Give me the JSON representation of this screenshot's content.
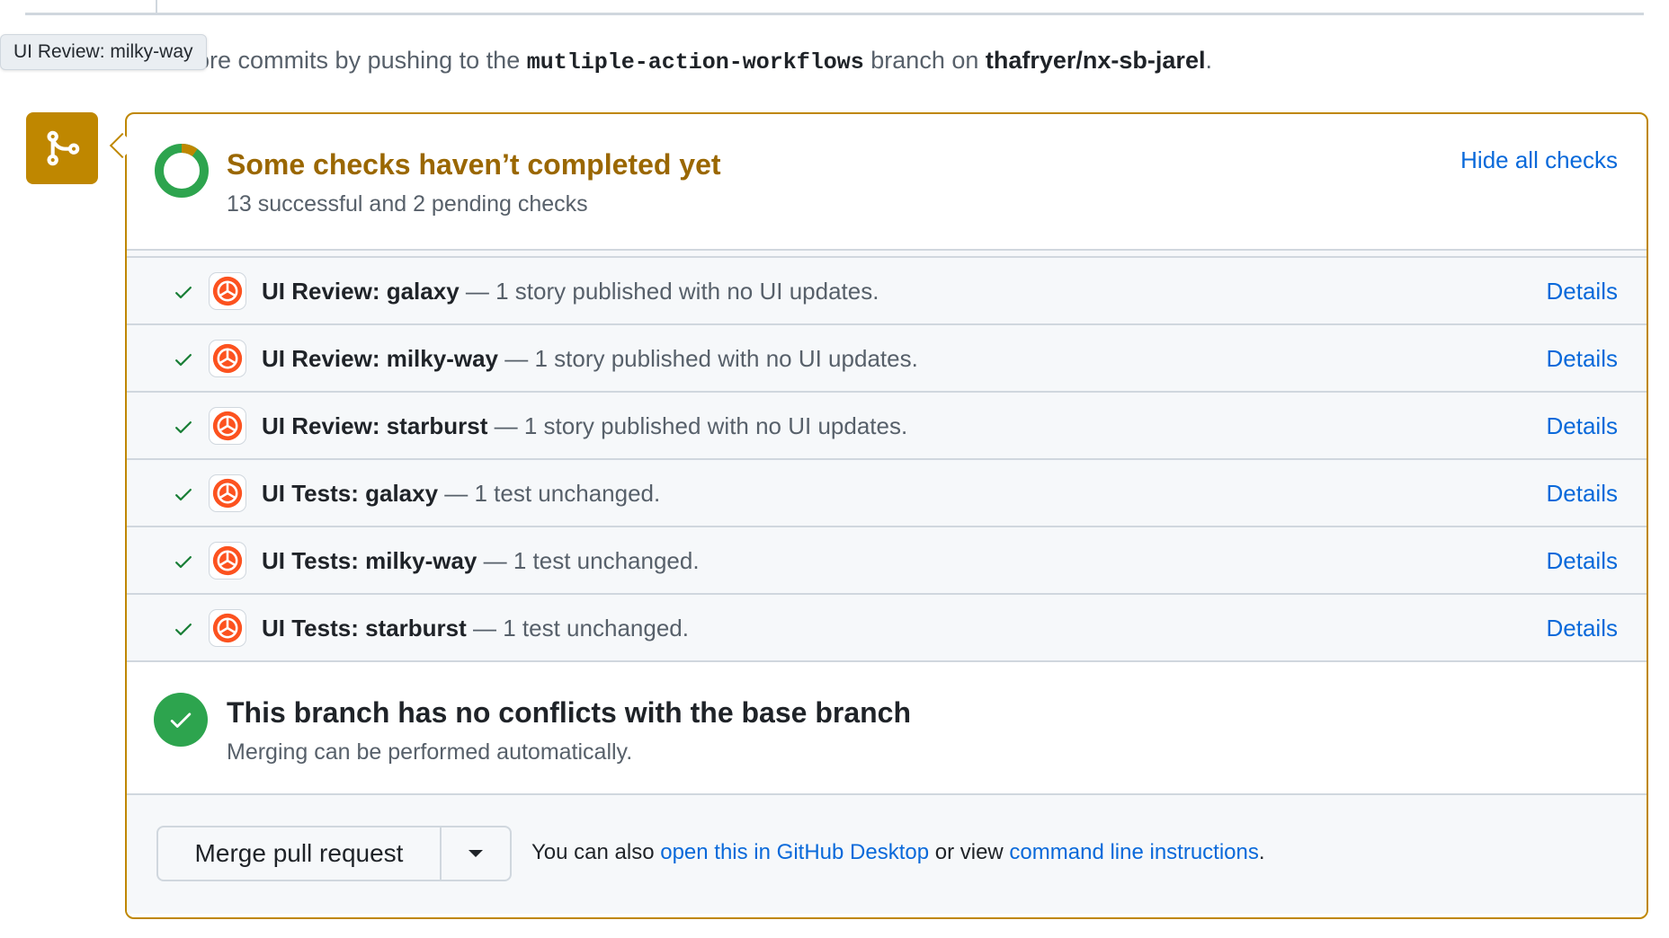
{
  "tooltip": {
    "text": "UI Review: milky-way"
  },
  "push": {
    "prefix": "Add more commits by pushing to the ",
    "branch": "mutliple-action-workflows",
    "middle": " branch on ",
    "repo": "thafryer/nx-sb-jarel",
    "suffix": "."
  },
  "status": {
    "title": "Some checks haven’t completed yet",
    "subtitle": "13 successful and 2 pending checks",
    "hide_link": "Hide all checks",
    "progress": {
      "successful": 13,
      "pending": 2
    },
    "colors": {
      "warning": "#bf8700",
      "success": "#2da44e",
      "link": "#0969da"
    }
  },
  "checks": [
    {
      "name": "UI Review: galaxy",
      "description": " — 1 story published with no UI updates.",
      "details": "Details"
    },
    {
      "name": "UI Review: milky-way",
      "description": " — 1 story published with no UI updates.",
      "details": "Details"
    },
    {
      "name": "UI Review: starburst",
      "description": " — 1 story published with no UI updates.",
      "details": "Details"
    },
    {
      "name": "UI Tests: galaxy",
      "description": " — 1 test unchanged.",
      "details": "Details"
    },
    {
      "name": "UI Tests: milky-way",
      "description": " — 1 test unchanged.",
      "details": "Details"
    },
    {
      "name": "UI Tests: starburst",
      "description": " — 1 test unchanged.",
      "details": "Details"
    }
  ],
  "conflict": {
    "title": "This branch has no conflicts with the base branch",
    "subtitle": "Merging can be performed automatically."
  },
  "merge": {
    "button": "Merge pull request",
    "also_prefix": "You can also ",
    "desktop_link": "open this in GitHub Desktop",
    "middle": " or view ",
    "cli_link": "command line instructions",
    "suffix": "."
  },
  "icons": {
    "merge": "git-merge-icon",
    "ring": "progress-ring-icon",
    "check": "check-icon",
    "app": "chromatic-icon",
    "success": "check-circle-icon",
    "dropdown": "triangle-down-icon"
  }
}
